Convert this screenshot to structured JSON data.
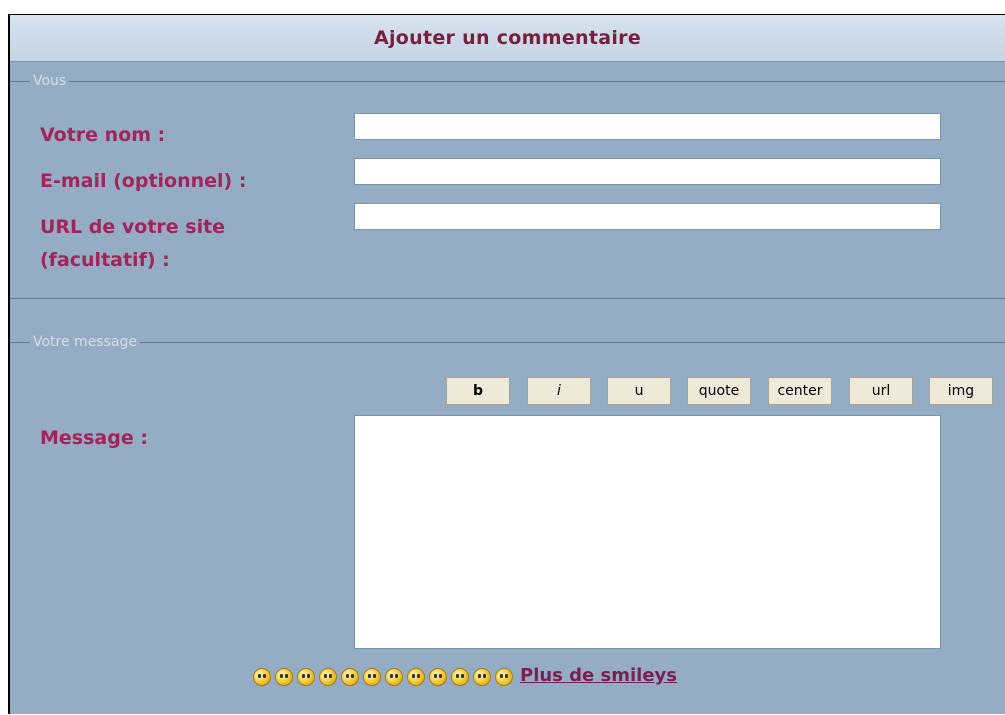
{
  "title": "Ajouter un commentaire",
  "section_you": {
    "legend": "Vous",
    "name_label": "Votre nom :",
    "email_label": "E-mail (optionnel) :",
    "url_label_line1": "URL de votre site",
    "url_label_line2": "(facultatif) :",
    "name_value": "",
    "email_value": "",
    "url_value": ""
  },
  "section_message": {
    "legend": "Votre message",
    "message_label": "Message :",
    "message_value": "",
    "buttons": [
      "b",
      "i",
      "u",
      "quote",
      "center",
      "url",
      "img"
    ]
  },
  "smileys": [
    "laugh-icon",
    "smile-icon",
    "cool-icon",
    "sad-icon",
    "tongue-icon",
    "grin-icon",
    "wink-icon",
    "frown-icon",
    "blush-icon",
    "happy-icon",
    "surprised-icon",
    "lol-icon"
  ],
  "more_smileys_link": "Plus de smileys",
  "colors": {
    "background": "#94adc5",
    "title": "#7a1f3a",
    "label": "#a4235a",
    "legend": "#d4dde7",
    "button": "#efe9da"
  }
}
